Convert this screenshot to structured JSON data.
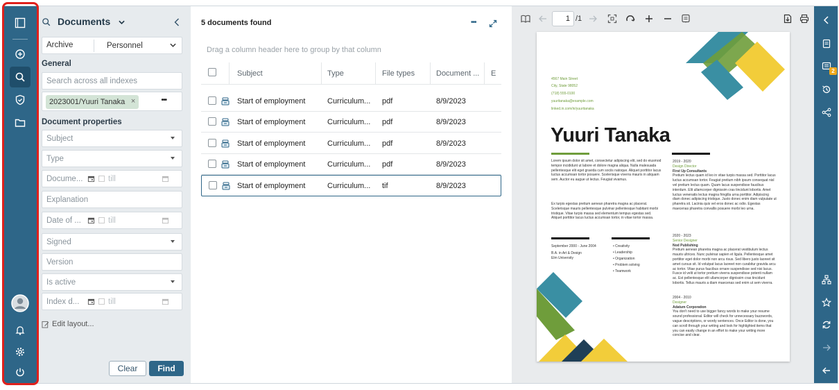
{
  "search_panel": {
    "title": "Documents",
    "archive_label": "Archive",
    "archive_value": "Personnel",
    "general_label": "General",
    "search_placeholder": "Search across all indexes",
    "chip": "2023001/Yuuri Tanaka",
    "chip_more": "•••",
    "properties_label": "Document properties",
    "fields": {
      "subject": "Subject",
      "type": "Type",
      "document_date": "Docume...",
      "explanation": "Explanation",
      "date_of": "Date of ...",
      "signed": "Signed",
      "version": "Version",
      "is_active": "Is active",
      "index_date": "Index d..."
    },
    "till": "till",
    "edit_layout": "Edit layout...",
    "clear": "Clear",
    "find": "Find"
  },
  "results": {
    "title": "5 documents found",
    "more": "•••",
    "group_hint": "Drag a column header here to group by that column",
    "columns": [
      "Subject",
      "Type",
      "File types",
      "Document ...",
      "E"
    ],
    "rows": [
      {
        "subject": "Start of employment",
        "type": "Curriculum...",
        "file_type": "pdf",
        "date": "8/9/2023"
      },
      {
        "subject": "Start of employment",
        "type": "Curriculum...",
        "file_type": "pdf",
        "date": "8/9/2023"
      },
      {
        "subject": "Start of employment",
        "type": "Curriculum...",
        "file_type": "pdf",
        "date": "8/9/2023"
      },
      {
        "subject": "Start of employment",
        "type": "Curriculum...",
        "file_type": "pdf",
        "date": "8/9/2023"
      },
      {
        "subject": "Start of employment",
        "type": "Curriculum...",
        "file_type": "tif",
        "date": "8/9/2023"
      }
    ]
  },
  "viewer": {
    "page_number": "1",
    "page_total": "/1",
    "cv": {
      "contact": [
        "4567 Main Street",
        "City, State 98052",
        "(718) 555-0100",
        "yuuritanaka@example.com",
        "linked.in.com/in/yuuritanaka"
      ],
      "name": "Yuuri Tanaka",
      "intro1": "Lorem ipsum dolor sit amet, consectetur adipiscing elit, sed do eiusmod tempor incididunt ut labore et dolore magna aliqua. Nulla malesuada pellentesque elit eget gravida cum sociis natoque. Aliquet porttitor lacus luctus accumsan tortor posuere. Scelerisque viverra mauris in aliquam sem. Auctor eu augue ut lectus. Feugiat vivamus.",
      "intro2": "Ex turpis egestas pretium aenean pharetra magna ac placerat. Scelerisque mauris pellentesque pulvinar pellentesque habitant morbi tristique. Vitae turpis massa sed elementum tempus egestas sed. Aliquet porttitor lacus luctus accumsan tortor, in vitae tortor massa.",
      "edu_date": "September 2000 - June 2004",
      "edu_degree": "B.A. in Art & Design",
      "edu_school": "Elm University",
      "skills": [
        "Creativity",
        "Leadership",
        "Organization",
        "Problem solving",
        "Teamwork"
      ],
      "jobs": [
        {
          "dates": "2019 - 2020",
          "title": "Design Director",
          "company": "First Up Consultants",
          "text": "Pretium lectus quam id leo in vitae turpis massa sed. Porttitor lacus luctus accumsan tortor. Feugiat pretium nibh ipsum consequat nisl vel pretium lectus quam. Quam lacus suspendisse faucibus interdum. Elit ullamcorper dignissim cras tincidunt lobortis. Amet luctus venenatis lectus magna fringilla urna porttitor. Adipiscing diam donec adipiscing tristique. Justo donec enim diam vulputate ut pharetra sit. Lacinia quis vel eros donec ac odio. Egestas maecenas pharetra convallis posuere morbi leo urna."
        },
        {
          "dates": "2020 - 2023",
          "title": "Senior Designer",
          "company": "Nod Publishing",
          "text": "Pretium aenean pharetra magna ac placerat vestibulum lectus mauris ultrices. Nunc pulvinar sapien et ligula. Pellentesque amet porttitor eget dolor morbi non arcu risus. Sed libero justo laoreet sit amet cursus sit. Id volutpat lacus laoreet non curabitur gravida arcu ac tortor. Vitae purus faucibus ornare suspendisse sed nisi lacus. Fusce id velit ut tortor pretium viverra suspendisse potenti nullam ac. Est pellentesque elit ullamcorper dignissim cras tincidunt lobortis. Tellus mauris a diam maecenas sed enim ut sem viverra."
        },
        {
          "dates": "2004 - 2010",
          "title": "Designer",
          "company": "Adatum Corporation",
          "text": "You don't need to use bigger fancy words to make your resume sound professional. Editor will check for unnecessary buzzwords, vague descriptions, or wordy sentences. Once Editor is done, you can scroll through your writing and look for highlighted items that you can easily change in an effort to make your writing more concise and clear."
        }
      ]
    }
  },
  "colors": {
    "rail": "#2e6688",
    "accent_green": "#6f9d3b",
    "accent_teal": "#3a8fa3",
    "accent_yellow": "#f2cd3a",
    "highlight": "#e0201c"
  }
}
